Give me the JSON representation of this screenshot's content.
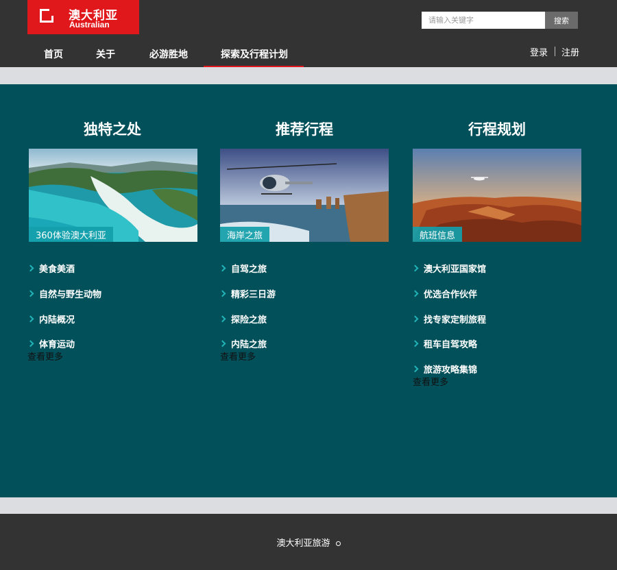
{
  "logo": {
    "cn": "澳大利亚",
    "en": "Australian"
  },
  "search": {
    "placeholder": "请输入关键字",
    "button": "搜索"
  },
  "nav": [
    "首页",
    "关于",
    "必游胜地",
    "探索及行程计划"
  ],
  "auth": {
    "login": "登录",
    "register": "注册"
  },
  "colors": {
    "accent": "#e0171b",
    "main_bg": "#02505a",
    "chevron": "#20b3b8"
  },
  "columns": [
    {
      "title": "独特之处",
      "image_label": "360体验澳大利亚",
      "links": [
        "美食美酒",
        "自然与野生动物",
        "内陆概况",
        "体育运动"
      ],
      "more": "查看更多"
    },
    {
      "title": "推荐行程",
      "image_label": "海岸之旅",
      "links": [
        "自驾之旅",
        "精彩三日游",
        "探险之旅",
        "内陆之旅"
      ],
      "more": "查看更多"
    },
    {
      "title": "行程规划",
      "image_label": "航班信息",
      "links": [
        "澳大利亚国家馆",
        "优选合作伙伴",
        "找专家定制旅程",
        "租车自驾攻略",
        "旅游攻略集锦"
      ],
      "more": "查看更多"
    }
  ],
  "footer": {
    "text": "澳大利亚旅游"
  }
}
